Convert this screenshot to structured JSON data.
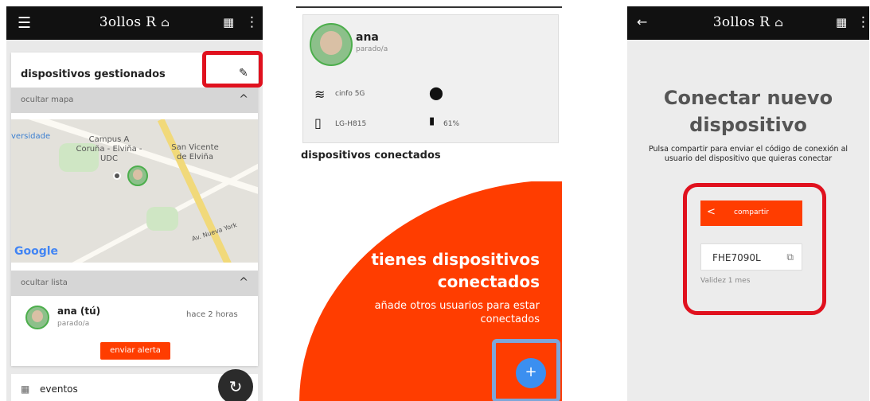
{
  "screen1": {
    "appbar": {
      "menu_icon": "menu-icon",
      "title": "3ollos R",
      "home_icon": "home-icon",
      "calendar_icon": "calendar-icon",
      "more_icon": "more-vert-icon"
    },
    "card_title": "dispositivos gestionados",
    "edit_icon": "pencil-icon",
    "hide_map_label": "ocultar mapa",
    "map": {
      "labels": [
        "versidade",
        "Campus A Coruña - Elviña - UDC",
        "San Vicente de Elviña",
        "Av. Nueva York"
      ],
      "google_label": "Google"
    },
    "hide_list_label": "ocultar lista",
    "list": [
      {
        "name": "ana (tú)",
        "status": "parado/a",
        "time": "hace 2 horas"
      }
    ],
    "alert_button": "enviar alerta",
    "events_label": "eventos",
    "refresh_icon": "refresh-icon",
    "highlight_color": "#e0111e"
  },
  "screen2": {
    "profile": {
      "name": "ana",
      "status": "parado/a"
    },
    "wifi": "cinfo 5G",
    "device": "LG-H815",
    "battery": "61%",
    "section_title": "dispositivos conectados",
    "empty_title": "tienes dispositivos conectados",
    "empty_subtitle": "añade otros usuarios para estar conectados",
    "add_icon": "plus-icon",
    "accent_color": "#ff3d00",
    "highlight_color": "#7da6d9"
  },
  "screen3": {
    "appbar": {
      "back_icon": "arrow-back-icon",
      "title": "3ollos R"
    },
    "title": "Conectar nuevo dispositivo",
    "description": "Pulsa compartir para enviar el código de conexión al usuario del dispositivo que quieras conectar",
    "share_button": "compartir",
    "code": "FHE7090L",
    "validity": "Validez 1 mes"
  }
}
